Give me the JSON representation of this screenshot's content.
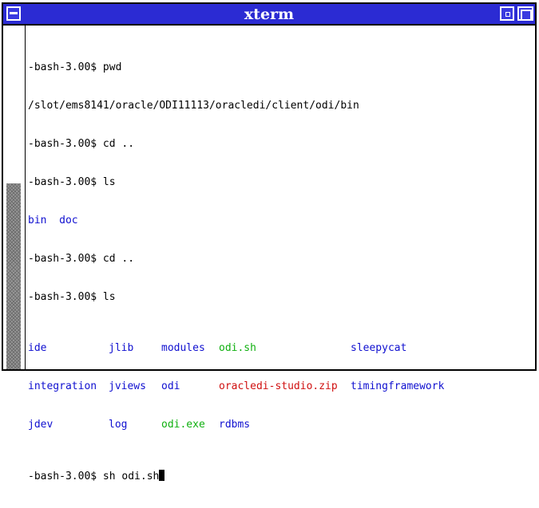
{
  "window": {
    "title": "xterm"
  },
  "colors": {
    "titlebar": "#2b2bd3",
    "directory": "#1010d0",
    "executable": "#10b010",
    "archive": "#d01010"
  },
  "terminal": {
    "line1": {
      "prompt": "-bash-3.00$ ",
      "command": "pwd"
    },
    "line2": {
      "output": "/slot/ems8141/oracle/ODI11113/oracledi/client/odi/bin"
    },
    "line3": {
      "prompt": "-bash-3.00$ ",
      "command": "cd .."
    },
    "line4": {
      "prompt": "-bash-3.00$ ",
      "command": "ls"
    },
    "line5": {
      "items": [
        "bin",
        "doc"
      ]
    },
    "line6": {
      "prompt": "-bash-3.00$ ",
      "command": "cd .."
    },
    "line7": {
      "prompt": "-bash-3.00$ ",
      "command": "ls"
    },
    "ls_row1": [
      "ide",
      "jlib",
      "modules",
      "odi.sh",
      "sleepycat"
    ],
    "ls_row2": [
      "integration",
      "jviews",
      "odi",
      "oracledi-studio.zip",
      "timingframework"
    ],
    "ls_row3": [
      "jdev",
      "log",
      "odi.exe",
      "rdbms"
    ],
    "current": {
      "prompt": "-bash-3.00$ ",
      "command": "sh odi.sh"
    }
  }
}
